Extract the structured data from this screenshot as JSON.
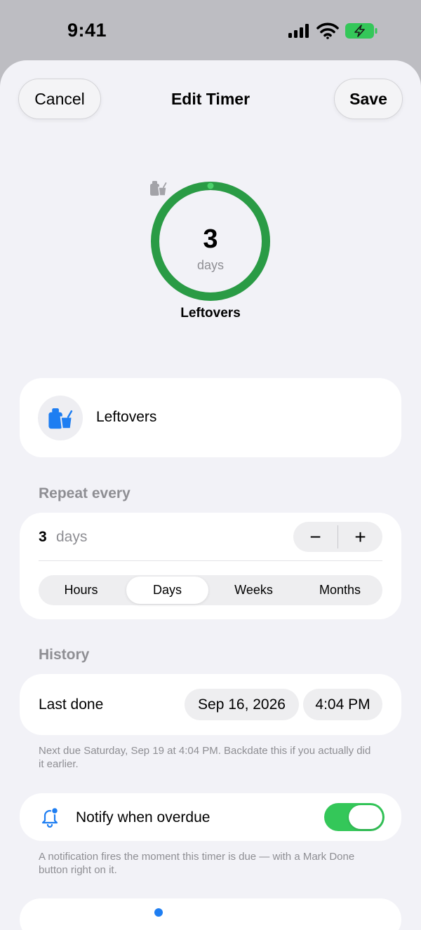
{
  "status_bar": {
    "time": "9:41"
  },
  "nav": {
    "cancel_label": "Cancel",
    "title": "Edit Timer",
    "save_label": "Save"
  },
  "timer_preview": {
    "value": "3",
    "unit": "days",
    "name": "Leftovers",
    "ring_color": "#2a9b45",
    "progress": 1.0,
    "icon": "leftovers-icon"
  },
  "name_row": {
    "icon": "leftovers-icon",
    "text": "Leftovers",
    "icon_color": "#1e7ef2"
  },
  "repeat": {
    "header": "Repeat every",
    "count": "3",
    "unit": "days",
    "minus_label": "−",
    "plus_label": "+",
    "segments": [
      "Hours",
      "Days",
      "Weeks",
      "Months"
    ],
    "selected_segment": "Days"
  },
  "history": {
    "header": "History",
    "last_done_label": "Last done",
    "date": "Sep 16, 2026",
    "time": "4:04 PM",
    "note": "Next due Saturday, Sep 19 at 4:04 PM. Backdate this if you actually did it earlier."
  },
  "notify": {
    "label": "Notify when overdue",
    "enabled": true,
    "toggle_color": "#34c759",
    "note": "A notification fires the moment this timer is due — with a Mark Done button right on it."
  },
  "colors": {
    "accent": "#1e7ef2",
    "sheet_bg": "#f2f2f7",
    "secondary_text": "#8e8e93"
  }
}
